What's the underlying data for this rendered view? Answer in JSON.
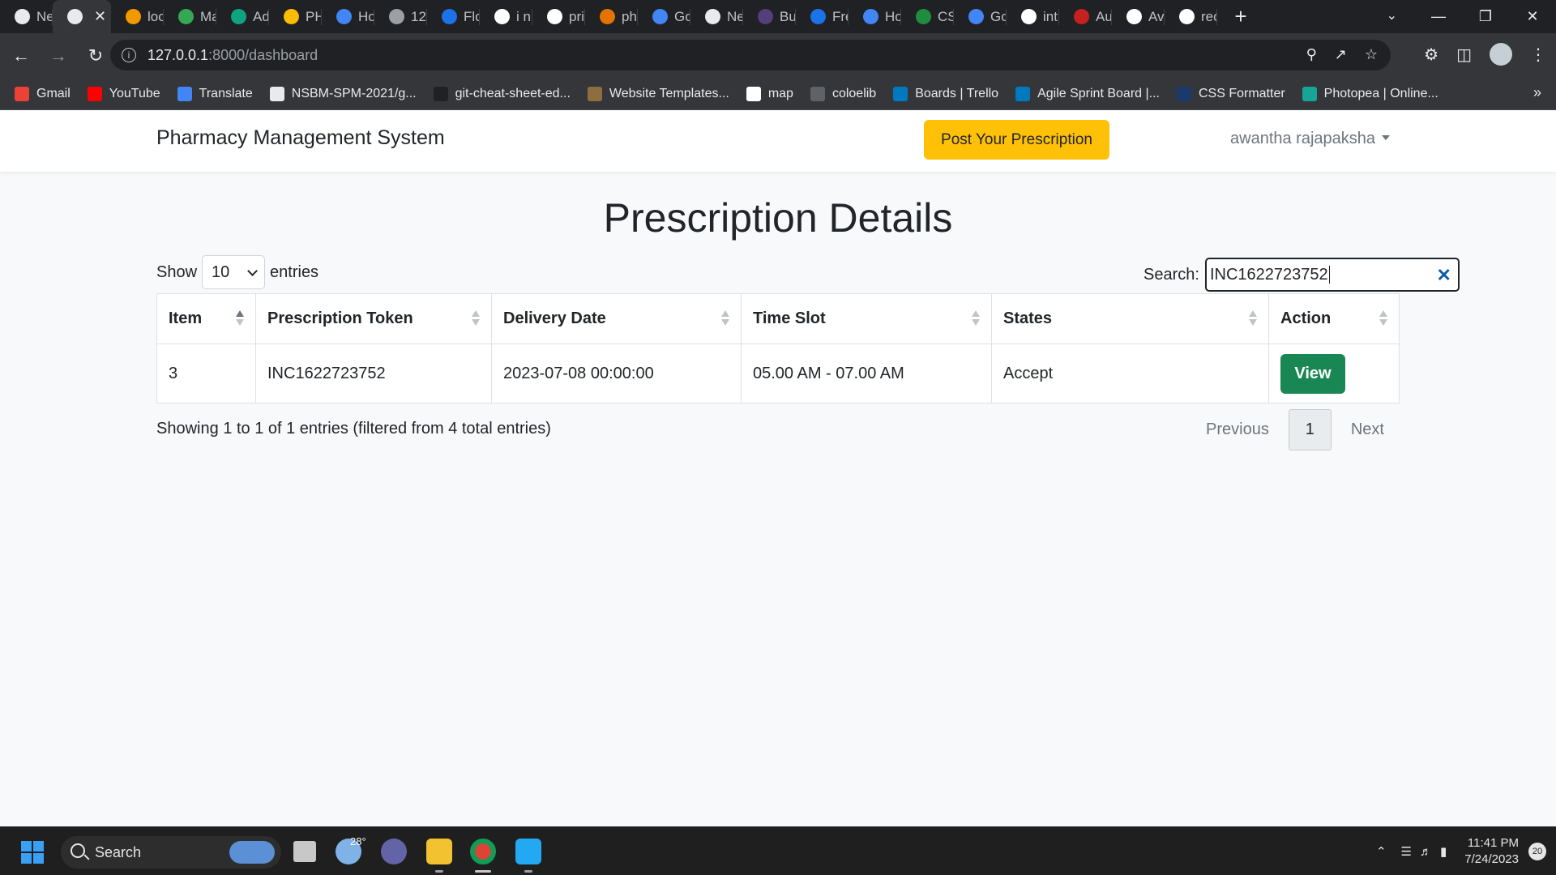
{
  "browser": {
    "tabs": [
      {
        "title": "Ne",
        "color": "#e8eaed"
      },
      {
        "title": "",
        "color": "#e8eaed",
        "active": true
      },
      {
        "title": "loc",
        "color": "#f29900"
      },
      {
        "title": "Ma",
        "color": "#34a853"
      },
      {
        "title": "Ad",
        "color": "#10a37f"
      },
      {
        "title": "PH",
        "color": "#fbbc04"
      },
      {
        "title": "Ho",
        "color": "#4285f4"
      },
      {
        "title": "12",
        "color": "#9aa0a6"
      },
      {
        "title": "Flo",
        "color": "#1a73e8"
      },
      {
        "title": "i n",
        "color": "#ffffff"
      },
      {
        "title": "pri",
        "color": "#ffffff"
      },
      {
        "title": "ph",
        "color": "#e37400"
      },
      {
        "title": "Go",
        "color": "#4285f4"
      },
      {
        "title": "Ne",
        "color": "#e8eaed"
      },
      {
        "title": "Bu",
        "color": "#563d7c"
      },
      {
        "title": "Fre",
        "color": "#1a73e8"
      },
      {
        "title": "Ho",
        "color": "#4285f4"
      },
      {
        "title": "CS",
        "color": "#1e8e3e"
      },
      {
        "title": "Go",
        "color": "#4285f4"
      },
      {
        "title": "int",
        "color": "#ffffff"
      },
      {
        "title": "Au",
        "color": "#c5221f"
      },
      {
        "title": "Av",
        "color": "#ffffff"
      },
      {
        "title": "rec",
        "color": "#ffffff"
      }
    ],
    "url_host": "127.0.0.1",
    "url_path": ":8000/dashboard",
    "bookmarks": [
      {
        "label": "Gmail",
        "color": "#ea4335"
      },
      {
        "label": "YouTube",
        "color": "#ff0000"
      },
      {
        "label": "Translate",
        "color": "#4285f4"
      },
      {
        "label": "NSBM-SPM-2021/g...",
        "color": "#e8eaed"
      },
      {
        "label": "git-cheat-sheet-ed...",
        "color": "#202124"
      },
      {
        "label": "Website Templates...",
        "color": "#8d6e3f"
      },
      {
        "label": "map",
        "color": "#ffffff"
      },
      {
        "label": "coloelib",
        "color": "#5f6368"
      },
      {
        "label": "Boards | Trello",
        "color": "#0079bf"
      },
      {
        "label": "Agile Sprint Board |...",
        "color": "#0079bf"
      },
      {
        "label": "CSS Formatter",
        "color": "#1a3a6b"
      },
      {
        "label": "Photopea | Online...",
        "color": "#18a497"
      }
    ]
  },
  "app": {
    "brand": "Pharmacy Management System",
    "post_button": "Post Your Prescription",
    "user_name": "awantha rajapaksha",
    "page_title": "Prescription Details",
    "length": {
      "show": "Show",
      "value": "10",
      "entries": "entries"
    },
    "search": {
      "label": "Search:",
      "value": "INC1622723752"
    },
    "table": {
      "headers": [
        "Item",
        "Prescription Token",
        "Delivery Date",
        "Time Slot",
        "States",
        "Action"
      ],
      "rows": [
        {
          "item": "3",
          "token": "INC1622723752",
          "delivery_date": "2023-07-08 00:00:00",
          "time_slot": "05.00 AM - 07.00 AM",
          "state": "Accept",
          "action": "View"
        }
      ]
    },
    "info": "Showing 1 to 1 of 1 entries (filtered from 4 total entries)",
    "pagination": {
      "previous": "Previous",
      "current": "1",
      "next": "Next"
    }
  },
  "taskbar": {
    "search_label": "Search",
    "weather_temp": "28°",
    "time": "11:41 PM",
    "date": "7/24/2023",
    "notifications": "20"
  },
  "colors": {
    "accent_yellow": "#ffc107",
    "view_green": "#198754",
    "page_bg": "#f8f9fa"
  }
}
